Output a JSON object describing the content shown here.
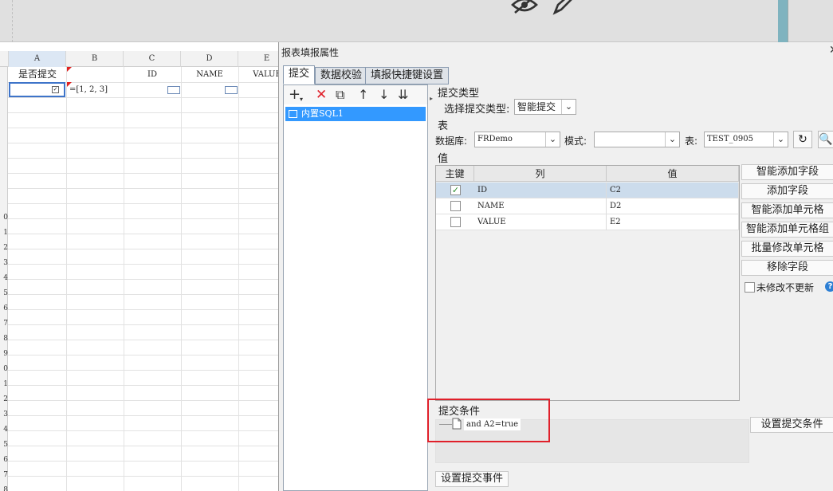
{
  "window_title": "报表填报属性",
  "top_icons": [
    "eye-off-icon",
    "pencil-icon"
  ],
  "spreadsheet": {
    "columns": [
      "A",
      "B",
      "C",
      "D",
      "E"
    ],
    "row_numbers": [
      "0",
      "1",
      "2",
      "3",
      "4",
      "5",
      "6",
      "7",
      "8",
      "9",
      "0",
      "1",
      "2",
      "3",
      "4",
      "5",
      "6",
      "7",
      "8"
    ],
    "row1": {
      "A": "是否提交",
      "C": "ID",
      "D": "NAME",
      "E": "VALUE"
    },
    "row2": {
      "B": "=[1, 2, 3]"
    }
  },
  "tabs": [
    "提交",
    "数据校验",
    "填报快捷键设置"
  ],
  "left_panel": {
    "toolbar_icons": [
      "add-icon",
      "delete-icon",
      "copy-icon",
      "move-up-icon",
      "move-down-icon",
      "sort-icon"
    ],
    "items": [
      "内置SQL1"
    ]
  },
  "submit_type": {
    "section_label": "提交类型",
    "select_label": "选择提交类型:",
    "select_value": "智能提交"
  },
  "table_section": {
    "section_label": "表",
    "database_label": "数据库:",
    "database_value": "FRDemo",
    "mode_label": "模式:",
    "mode_value": "",
    "table_label": "表:",
    "table_value": "TEST_0905"
  },
  "value_section": {
    "section_label": "值",
    "headers": [
      "主键",
      "列",
      "值"
    ],
    "rows": [
      {
        "key": true,
        "column": "ID",
        "value": "C2"
      },
      {
        "key": false,
        "column": "NAME",
        "value": "D2"
      },
      {
        "key": false,
        "column": "VALUE",
        "value": "E2"
      }
    ]
  },
  "side_buttons": [
    "智能添加字段",
    "添加字段",
    "智能添加单元格",
    "智能添加单元格组",
    "批量修改单元格",
    "移除字段"
  ],
  "unmodified_checkbox_label": "未修改不更新",
  "condition_section": {
    "section_label": "提交条件",
    "condition_text": "and A2=true",
    "set_button": "设置提交条件"
  },
  "event_button": "设置提交事件",
  "accent_color": "#3399ff",
  "highlight_color": "#e0202a"
}
